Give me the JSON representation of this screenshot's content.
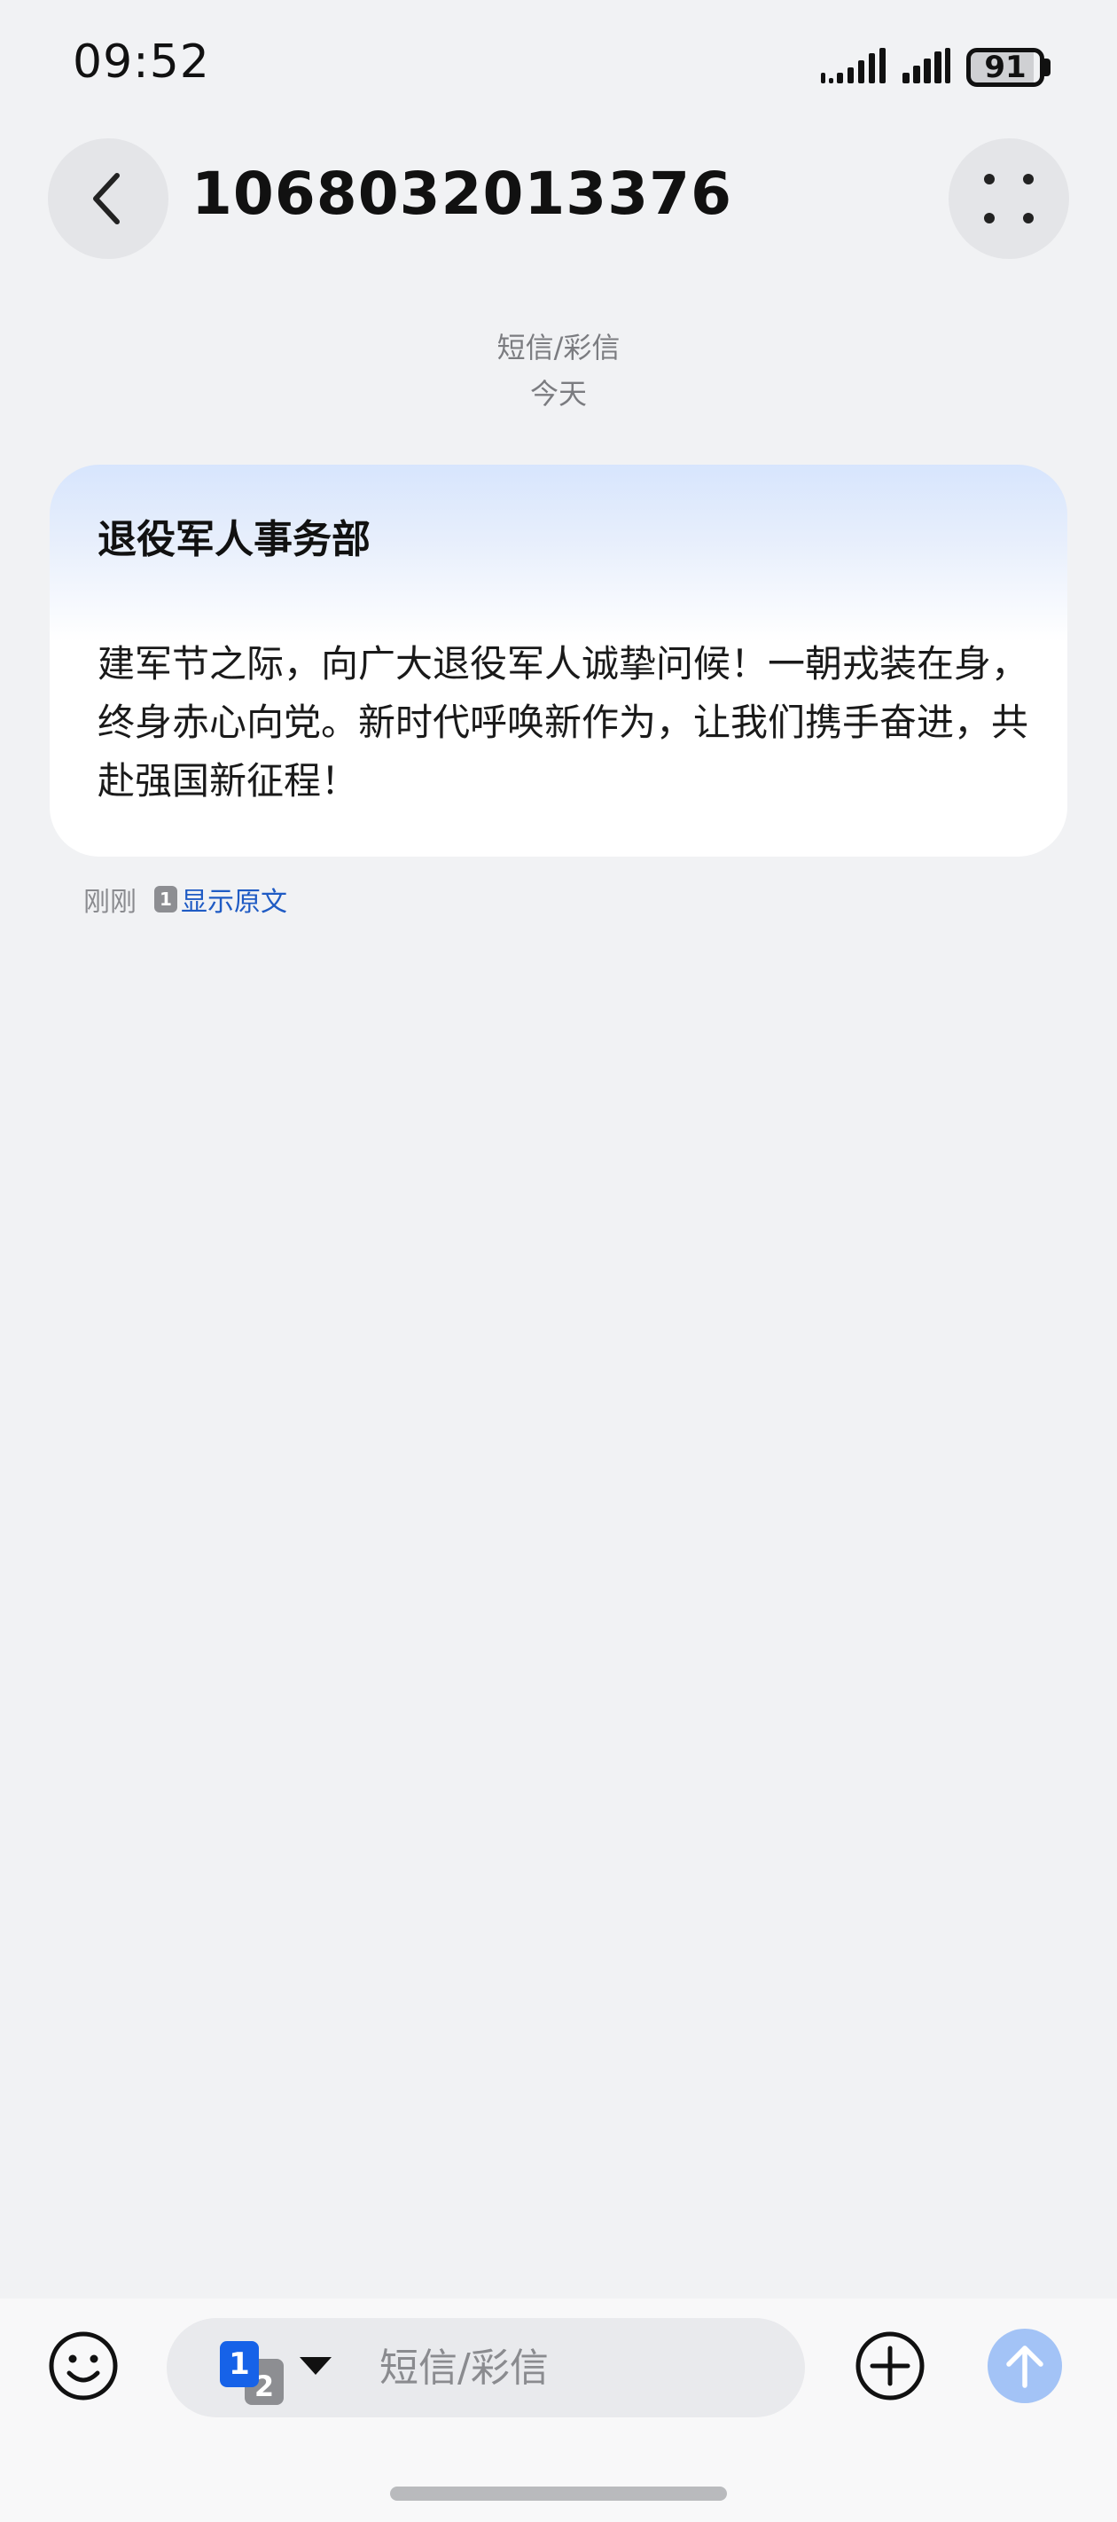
{
  "status_bar": {
    "time": "09:52",
    "battery_level": "91",
    "icons": [
      "signal-bars-icon",
      "signal-bars-icon",
      "battery-icon"
    ]
  },
  "header": {
    "title": "1068032013376",
    "back_icon": "chevron-left-icon",
    "more_icon": "dots-grid-icon"
  },
  "thread": {
    "channel_label": "短信/彩信",
    "date_label": "今天"
  },
  "message": {
    "sender": "退役军人事务部",
    "body": "建军节之际，向广大退役军人诚挚问候！一朝戎装在身，终身赤心向党。新时代呼唤新作为，让我们携手奋进，共赴强国新征程！",
    "time": "刚刚",
    "sim_slot": "1",
    "show_original_label": "显示原文",
    "card_gradient_top": "#d7e5fd"
  },
  "composer": {
    "placeholder": "短信/彩信",
    "sim_primary": "1",
    "sim_secondary": "2",
    "emoji_icon": "smiley-icon",
    "add_icon": "plus-circle-icon",
    "send_icon": "arrow-up-icon"
  },
  "colors": {
    "background": "#f1f2f4",
    "link": "#1f5bc4",
    "sim_primary": "#1662e8",
    "send_button": "#a3c3f6"
  }
}
